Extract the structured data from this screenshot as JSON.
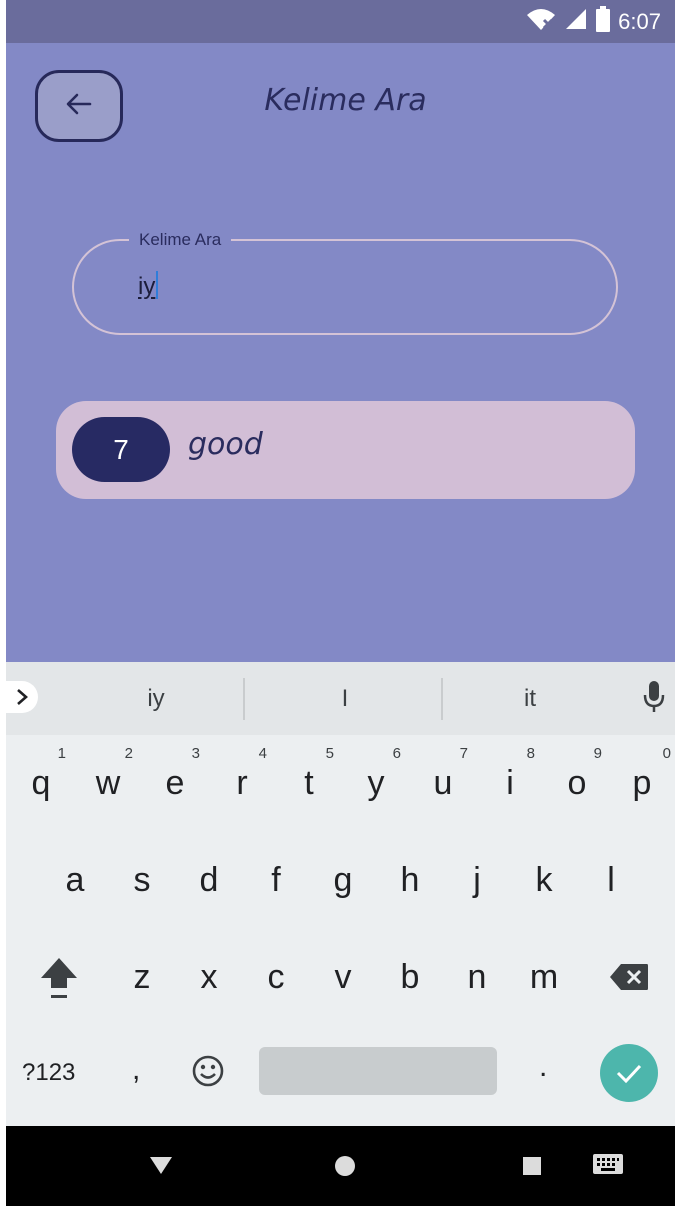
{
  "status_bar": {
    "time": "6:07"
  },
  "header": {
    "title": "Kelime Ara"
  },
  "search": {
    "label": "Kelime Ara",
    "value": "iy"
  },
  "results": [
    {
      "number": "7",
      "word": "good"
    }
  ],
  "keyboard": {
    "suggestions": [
      "iy",
      "I",
      "it"
    ],
    "row1": [
      {
        "key": "q",
        "hint": "1"
      },
      {
        "key": "w",
        "hint": "2"
      },
      {
        "key": "e",
        "hint": "3"
      },
      {
        "key": "r",
        "hint": "4"
      },
      {
        "key": "t",
        "hint": "5"
      },
      {
        "key": "y",
        "hint": "6"
      },
      {
        "key": "u",
        "hint": "7"
      },
      {
        "key": "i",
        "hint": "8"
      },
      {
        "key": "o",
        "hint": "9"
      },
      {
        "key": "p",
        "hint": "0"
      }
    ],
    "row2": [
      "a",
      "s",
      "d",
      "f",
      "g",
      "h",
      "j",
      "k",
      "l"
    ],
    "row3": [
      "z",
      "x",
      "c",
      "v",
      "b",
      "n",
      "m"
    ],
    "symbols_label": "?123",
    "comma": ",",
    "period": "."
  }
}
